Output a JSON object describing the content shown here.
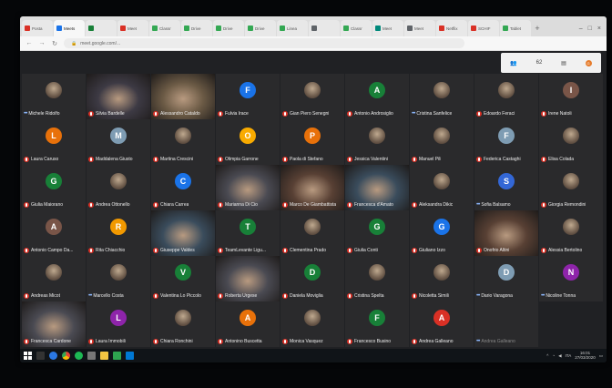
{
  "browser": {
    "tabs": [
      {
        "label": "Posta",
        "color": "#d93025"
      },
      {
        "label": "Meets",
        "color": "#1a73e8"
      },
      {
        "label": "",
        "color": "#188038"
      },
      {
        "label": "Meet",
        "color": "#d93025"
      },
      {
        "label": "Classr",
        "color": "#34a853"
      },
      {
        "label": "Drive",
        "color": "#34a853"
      },
      {
        "label": "Drive",
        "color": "#34a853"
      },
      {
        "label": "Drive",
        "color": "#34a853"
      },
      {
        "label": "Linea",
        "color": "#34a853"
      },
      {
        "label": "",
        "color": "#5f6368"
      },
      {
        "label": "Classr",
        "color": "#34a853"
      },
      {
        "label": "Meet",
        "color": "#00897b"
      },
      {
        "label": "Meet",
        "color": "#5f6368"
      },
      {
        "label": "Netflix",
        "color": "#d93025"
      },
      {
        "label": "SCHIF",
        "color": "#d93025"
      },
      {
        "label": "Tablet",
        "color": "#34a853"
      }
    ],
    "new_tab_label": "+",
    "url": "meet.google.com/..."
  },
  "meet_panel": {
    "people_icon": "people-icon",
    "participant_count": "62",
    "chat_icon": "chat-icon",
    "avatar_badge": "G"
  },
  "participants": [
    {
      "name": "Michele Ridolfo",
      "type": "photo",
      "audio": "speaking"
    },
    {
      "name": "Silvia Bardelle",
      "type": "video",
      "audio": "muted",
      "wide": true
    },
    {
      "name": "Alessandro Cataldo",
      "type": "video",
      "audio": "muted"
    },
    {
      "name": "Fulvia Irace",
      "type": "letter",
      "letter": "F",
      "color": "#1a73e8",
      "audio": "muted"
    },
    {
      "name": "Gian Piero Senegni",
      "type": "photo",
      "audio": "muted"
    },
    {
      "name": "Antonio Androsiglio",
      "type": "letter",
      "letter": "A",
      "color": "#188038",
      "audio": "muted"
    },
    {
      "name": "Cristina Sanfelice",
      "type": "photo",
      "audio": "speaking"
    },
    {
      "name": "Edoardo Feraci",
      "type": "photo",
      "audio": "muted"
    },
    {
      "name": "Irene Natoli",
      "type": "letter",
      "letter": "I",
      "color": "#795548",
      "audio": "muted"
    },
    {
      "name": "Laura Caruso",
      "type": "letter",
      "letter": "L",
      "color": "#e8710a",
      "audio": "muted"
    },
    {
      "name": "Maddalena Giusto",
      "type": "letter",
      "letter": "M",
      "color": "#7e9cb3",
      "audio": "muted"
    },
    {
      "name": "Martina Crescini",
      "type": "photo",
      "audio": "muted"
    },
    {
      "name": "Olimpia Garrone",
      "type": "letter",
      "letter": "O",
      "color": "#f9ab00",
      "audio": "muted"
    },
    {
      "name": "Paola di Stefano",
      "type": "letter",
      "letter": "P",
      "color": "#e8710a",
      "audio": "muted"
    },
    {
      "name": "Jessica Valentini",
      "type": "photo",
      "audio": "muted"
    },
    {
      "name": "Manuel Pili",
      "type": "photo",
      "audio": "muted"
    },
    {
      "name": "Federica Castaghi",
      "type": "letter",
      "letter": "F",
      "color": "#7e9cb3",
      "audio": "muted"
    },
    {
      "name": "Elisa Colada",
      "type": "photo",
      "audio": "muted"
    },
    {
      "name": "Giulia Maiorano",
      "type": "letter",
      "letter": "G",
      "color": "#188038",
      "audio": "muted"
    },
    {
      "name": "Andrea Ottonello",
      "type": "photo",
      "audio": "muted"
    },
    {
      "name": "Chiara Carrea",
      "type": "letter",
      "letter": "C",
      "color": "#1a73e8",
      "audio": "muted"
    },
    {
      "name": "Marianna Di Cio",
      "type": "video",
      "audio": "muted"
    },
    {
      "name": "Marco De Giambattista",
      "type": "video",
      "audio": "muted"
    },
    {
      "name": "Francesca d'Amato",
      "type": "video",
      "audio": "muted"
    },
    {
      "name": "Aleksandra Dikic",
      "type": "photo",
      "audio": "muted"
    },
    {
      "name": "Sofia Balsamo",
      "type": "letter",
      "letter": "S",
      "color": "#3367d6",
      "audio": "speaking"
    },
    {
      "name": "Giorgia Remondini",
      "type": "photo",
      "audio": "muted"
    },
    {
      "name": "Antonio Campo Da...",
      "type": "letter",
      "letter": "A",
      "color": "#795548",
      "audio": "muted"
    },
    {
      "name": "Rita Chiacchio",
      "type": "letter",
      "letter": "R",
      "color": "#f29900",
      "audio": "muted"
    },
    {
      "name": "Giuseppe Valdes",
      "type": "video",
      "audio": "muted"
    },
    {
      "name": "TeamLevante Ligu...",
      "type": "letter",
      "letter": "T",
      "color": "#188038",
      "audio": "muted"
    },
    {
      "name": "Clementina Prado",
      "type": "photo",
      "audio": "muted"
    },
    {
      "name": "Giulia Conti",
      "type": "letter",
      "letter": "G",
      "color": "#188038",
      "audio": "muted"
    },
    {
      "name": "Giuliano Izzo",
      "type": "letter",
      "letter": "G",
      "color": "#1a73e8",
      "audio": "muted"
    },
    {
      "name": "Onofrio Altini",
      "type": "video",
      "audio": "muted"
    },
    {
      "name": "Alessia Bertolino",
      "type": "photo",
      "audio": "muted"
    },
    {
      "name": "Andreas Micot",
      "type": "photo",
      "audio": "muted"
    },
    {
      "name": "Marcello Costa",
      "type": "photo",
      "audio": "speaking"
    },
    {
      "name": "Valentina Lo Piccolo",
      "type": "letter",
      "letter": "V",
      "color": "#188038",
      "audio": "muted"
    },
    {
      "name": "Roberta Urgese",
      "type": "video",
      "audio": "muted"
    },
    {
      "name": "Daniela Moviglia",
      "type": "letter",
      "letter": "D",
      "color": "#188038",
      "audio": "muted"
    },
    {
      "name": "Cristina Spelta",
      "type": "photo",
      "audio": "muted"
    },
    {
      "name": "Nicoletta Simili",
      "type": "photo",
      "audio": "muted"
    },
    {
      "name": "Dario Varagona",
      "type": "letter",
      "letter": "D",
      "color": "#7e9cb3",
      "audio": "speaking"
    },
    {
      "name": "Nicoline Tonna",
      "type": "letter",
      "letter": "N",
      "color": "#8e24aa",
      "audio": "speaking"
    },
    {
      "name": "Francesca Cardone",
      "type": "video",
      "audio": "muted"
    },
    {
      "name": "Laura Immobili",
      "type": "letter",
      "letter": "L",
      "color": "#8e24aa",
      "audio": "muted"
    },
    {
      "name": "Chiara Ronchini",
      "type": "photo",
      "audio": "muted"
    },
    {
      "name": "Antonino Buscetta",
      "type": "letter",
      "letter": "A",
      "color": "#e8710a",
      "audio": "muted"
    },
    {
      "name": "Monica Vasquez",
      "type": "photo",
      "audio": "muted"
    },
    {
      "name": "Francesco Busino",
      "type": "letter",
      "letter": "F",
      "color": "#188038",
      "audio": "muted"
    },
    {
      "name": "Andrea Galleano",
      "type": "letter",
      "letter": "A",
      "color": "#d93025",
      "audio": "muted"
    },
    {
      "name": "Andrea Galleano",
      "type": "blank",
      "audio": "speaking"
    }
  ],
  "taskbar": {
    "time": "16:01",
    "date": "27/03/2020",
    "lang": "ITA"
  }
}
